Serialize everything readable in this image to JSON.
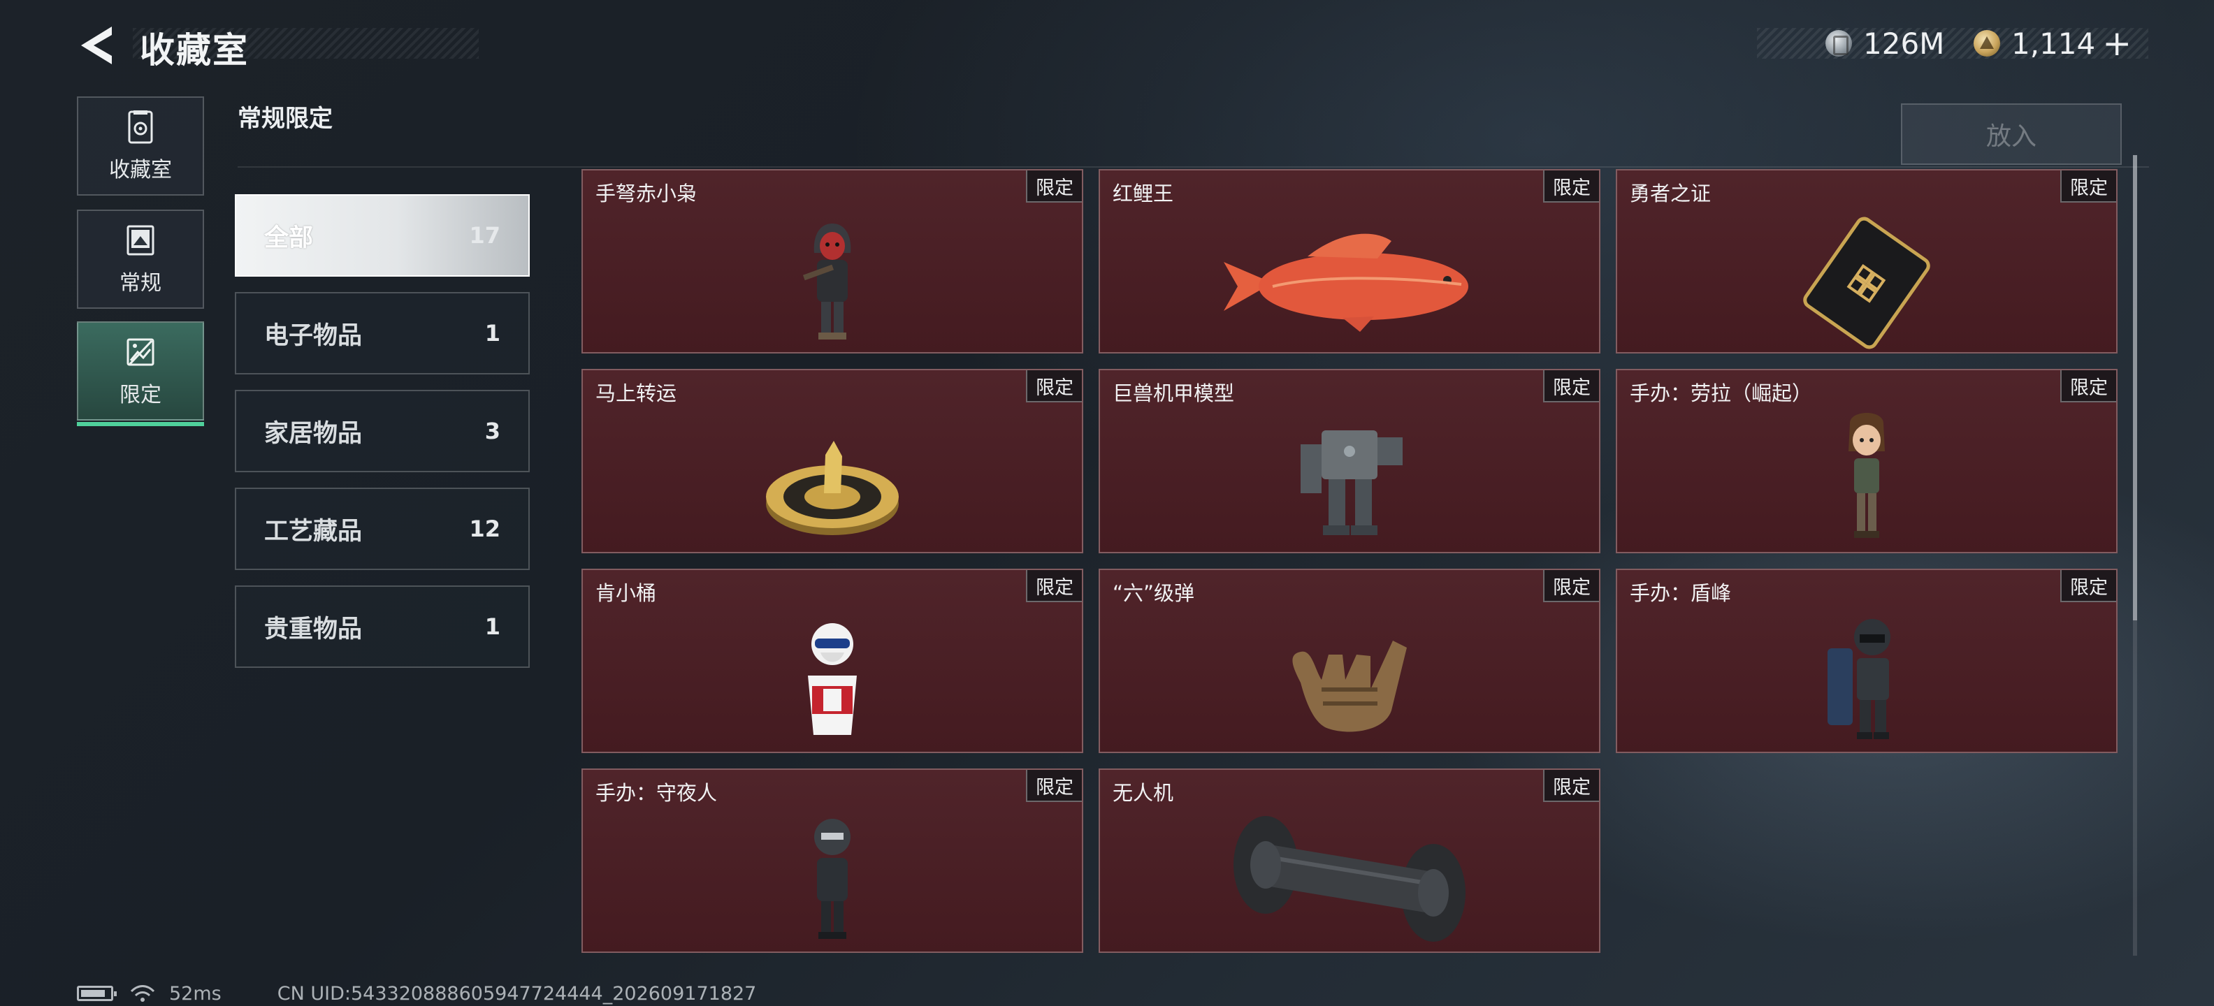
{
  "header": {
    "title": "收藏室"
  },
  "currency": {
    "silver": "126M",
    "gold": "1,114",
    "add_label": "+"
  },
  "nav": [
    {
      "label": "收藏室",
      "icon": "vault-icon"
    },
    {
      "label": "常规",
      "icon": "image-card-icon"
    },
    {
      "label": "限定",
      "icon": "image-slash-icon",
      "active": true
    }
  ],
  "section": {
    "title": "常规限定"
  },
  "categories": [
    {
      "label": "全部",
      "count": "17",
      "active": true
    },
    {
      "label": "电子物品",
      "count": "1"
    },
    {
      "label": "家居物品",
      "count": "3"
    },
    {
      "label": "工艺藏品",
      "count": "12"
    },
    {
      "label": "贵重物品",
      "count": "1"
    }
  ],
  "put_button": {
    "label": "放入",
    "enabled": false
  },
  "items": [
    {
      "name": "手弩赤小枭",
      "tag": "限定",
      "icon": "hooded-figure-icon"
    },
    {
      "name": "红鲤王",
      "tag": "限定",
      "icon": "red-carp-icon"
    },
    {
      "name": "勇者之证",
      "tag": "限定",
      "icon": "badge-card-icon"
    },
    {
      "name": "马上转运",
      "tag": "限定",
      "icon": "golden-horse-disc-icon"
    },
    {
      "name": "巨兽机甲模型",
      "tag": "限定",
      "icon": "mech-model-icon"
    },
    {
      "name": "手办：劳拉（崛起）",
      "tag": "限定",
      "icon": "lara-figure-icon"
    },
    {
      "name": "肯小桶",
      "tag": "限定",
      "icon": "colonel-bucket-icon"
    },
    {
      "name": "“六”级弹",
      "tag": "限定",
      "icon": "six-hand-sign-icon"
    },
    {
      "name": "手办：盾峰",
      "tag": "限定",
      "icon": "shield-soldier-icon"
    },
    {
      "name": "手办：守夜人",
      "tag": "限定",
      "icon": "night-watch-figure-icon"
    },
    {
      "name": "无人机",
      "tag": "限定",
      "icon": "drone-roller-icon"
    }
  ],
  "footer": {
    "ping": "52ms",
    "uid": "CN UID:543320888605947724444_202609171827"
  },
  "colors": {
    "card_bg": "#4a1d23",
    "active_nav": "#3b6b5f",
    "active_indicator": "#4fd09b"
  }
}
